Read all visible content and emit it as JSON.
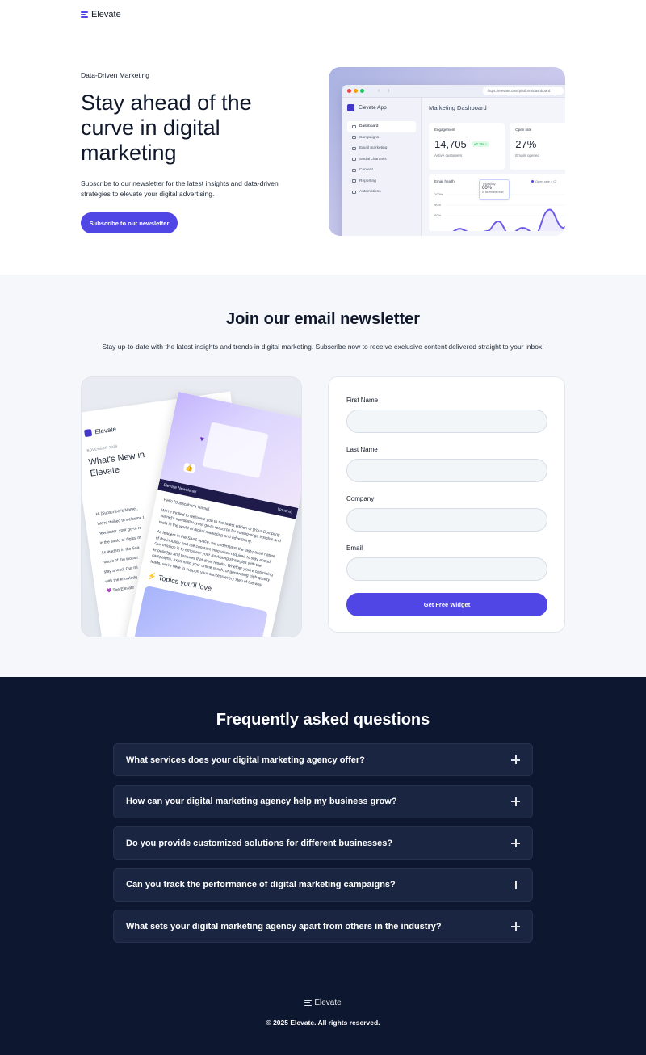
{
  "header": {
    "brand": "Elevate"
  },
  "hero": {
    "eyebrow": "Data-Driven Marketing",
    "title": "Stay ahead of the curve in digital marketing",
    "description": "Subscribe to our newsletter for the latest insights and data-driven strategies to elevate your digital advertising.",
    "cta_label": "Subscribe to our newsletter"
  },
  "dashboard": {
    "url": "https://elevate.com/platform/dashboard",
    "app_name": "Elevate App",
    "title": "Marketing Dashboard",
    "nav": [
      "Dashboard",
      "Campaigns",
      "Email marketing",
      "Social channels",
      "Content",
      "Reporting",
      "Automations"
    ],
    "engagement": {
      "label": "Engagement",
      "value": "14,705",
      "badge": "+2.3% ↑",
      "sub": "Active customers"
    },
    "open_rate": {
      "label": "Open rate",
      "value": "27%",
      "sub": "Emails opened"
    },
    "email_health": {
      "title": "Email health",
      "legend": "Open rate  ○ Cl",
      "ticks": [
        "100%",
        "90%",
        "80%"
      ],
      "tooltip": {
        "day": "Thursday",
        "value": "60%",
        "sub": "of all emails read"
      }
    },
    "colors": {
      "accent": "#4f46e5",
      "dot_red": "#ef4444",
      "dot_yellow": "#f59e0b",
      "dot_green": "#22c55e"
    }
  },
  "newsletter": {
    "title": "Join our email newsletter",
    "description": "Stay up-to-date with the latest insights and trends in digital marketing. Subscribe now to receive exclusive content delivered straight to your inbox.",
    "preview": {
      "brand": "Elevate",
      "date": "NOVEMBER 2024",
      "headline": "What's New in Elevate",
      "greeting": "Hi [Subscriber's Name],",
      "back_lines": [
        "We're thrilled to welcome t",
        "newsletter, your go-to re",
        "in the world of digital m",
        "As leaders in the Saa",
        "nature of the industr",
        "stay ahead. Our mi",
        "with the knowledg",
        "💜 The Elevate"
      ],
      "band_left": "Elevate Newsletter",
      "band_right": "Novemb",
      "front_greeting": "Hello [Subscriber's Name],",
      "front_p1": "We're thrilled to welcome you to the latest edition of [Your Company Name]'s newsletter, your go-to resource for cutting-edge insights and tools in the world of digital marketing and advertising.",
      "front_p2": "As leaders in the SaaS space, we understand the fast-paced nature of the industry and the constant innovation required to stay ahead. Our mission is to empower your marketing strategies with the knowledge and features that drive results. Whether you're optimizing campaigns, expanding your online reach, or generating high-quality leads, we're here to support your success every step of the way.",
      "topics": "Topics you'll love"
    },
    "form": {
      "first_name_label": "First Name",
      "last_name_label": "Last Name",
      "company_label": "Company",
      "email_label": "Email",
      "submit_label": "Get Free Widget"
    }
  },
  "faq": {
    "title": "Frequently asked questions",
    "items": [
      "What services does your digital marketing agency offer?",
      "How can your digital marketing agency help my business grow?",
      "Do you provide customized solutions for different businesses?",
      "Can you track the performance of digital marketing campaigns?",
      "What sets your digital marketing agency apart from others in the industry?"
    ]
  },
  "footer": {
    "brand": "Elevate",
    "copyright": "© 2025 Elevate. All rights reserved."
  },
  "icons": [
    "elevate-logo-icon",
    "plus-icon",
    "heart-icon",
    "thumbs-up-icon",
    "lock-icon"
  ]
}
